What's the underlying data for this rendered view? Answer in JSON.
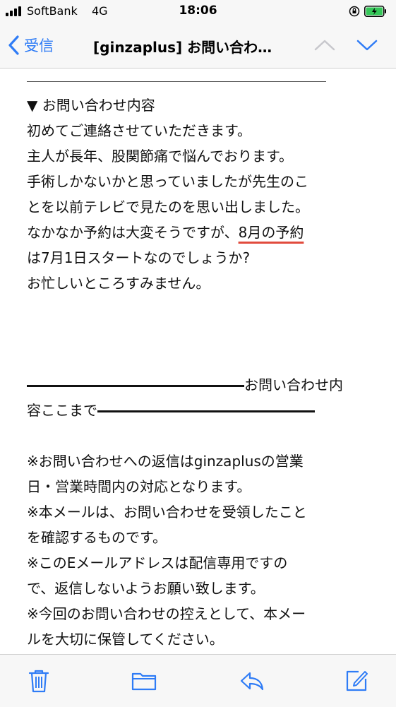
{
  "status_bar": {
    "carrier": "SoftBank",
    "network": "4G",
    "time": "18:06"
  },
  "nav": {
    "back_label": "受信",
    "title": "[ginzaplus] お問い合わ…"
  },
  "body": {
    "section_header": "▼ お問い合わせ内容",
    "lines": [
      "初めてご連絡させていただきます。",
      "主人が長年、股関節痛で悩んでおります。",
      "手術しかないかと思っていましたが先生のこ",
      "とを以前テレビで見たのを思い出しました。"
    ],
    "line5_prefix": "なかなか予約は大変そうですが、",
    "line5_highlight": "8月の予約",
    "line6": "は7月1日スタートなのでしょうか?",
    "line7": "お忙しいところすみません。",
    "end_marker_1": "お問い合わせ内",
    "end_marker_2": "容ここまで",
    "notices": [
      "※お問い合わせへの返信はginzaplusの営業",
      "日・営業時間内の対応となります。",
      "※本メールは、お問い合わせを受領したこと",
      "を確認するものです。",
      "※このEメールアドレスは配信専用ですの",
      "で、返信しないようお願い致します。",
      "※今回のお問い合わせの控えとして、本メー",
      "ルを大切に保管してください。"
    ]
  },
  "toolbar": {
    "icons": [
      "trash-icon",
      "folder-icon",
      "reply-icon",
      "compose-icon"
    ]
  },
  "colors": {
    "accent": "#2f7cf6",
    "underline": "#e14b3d",
    "battery": "#35c759"
  }
}
